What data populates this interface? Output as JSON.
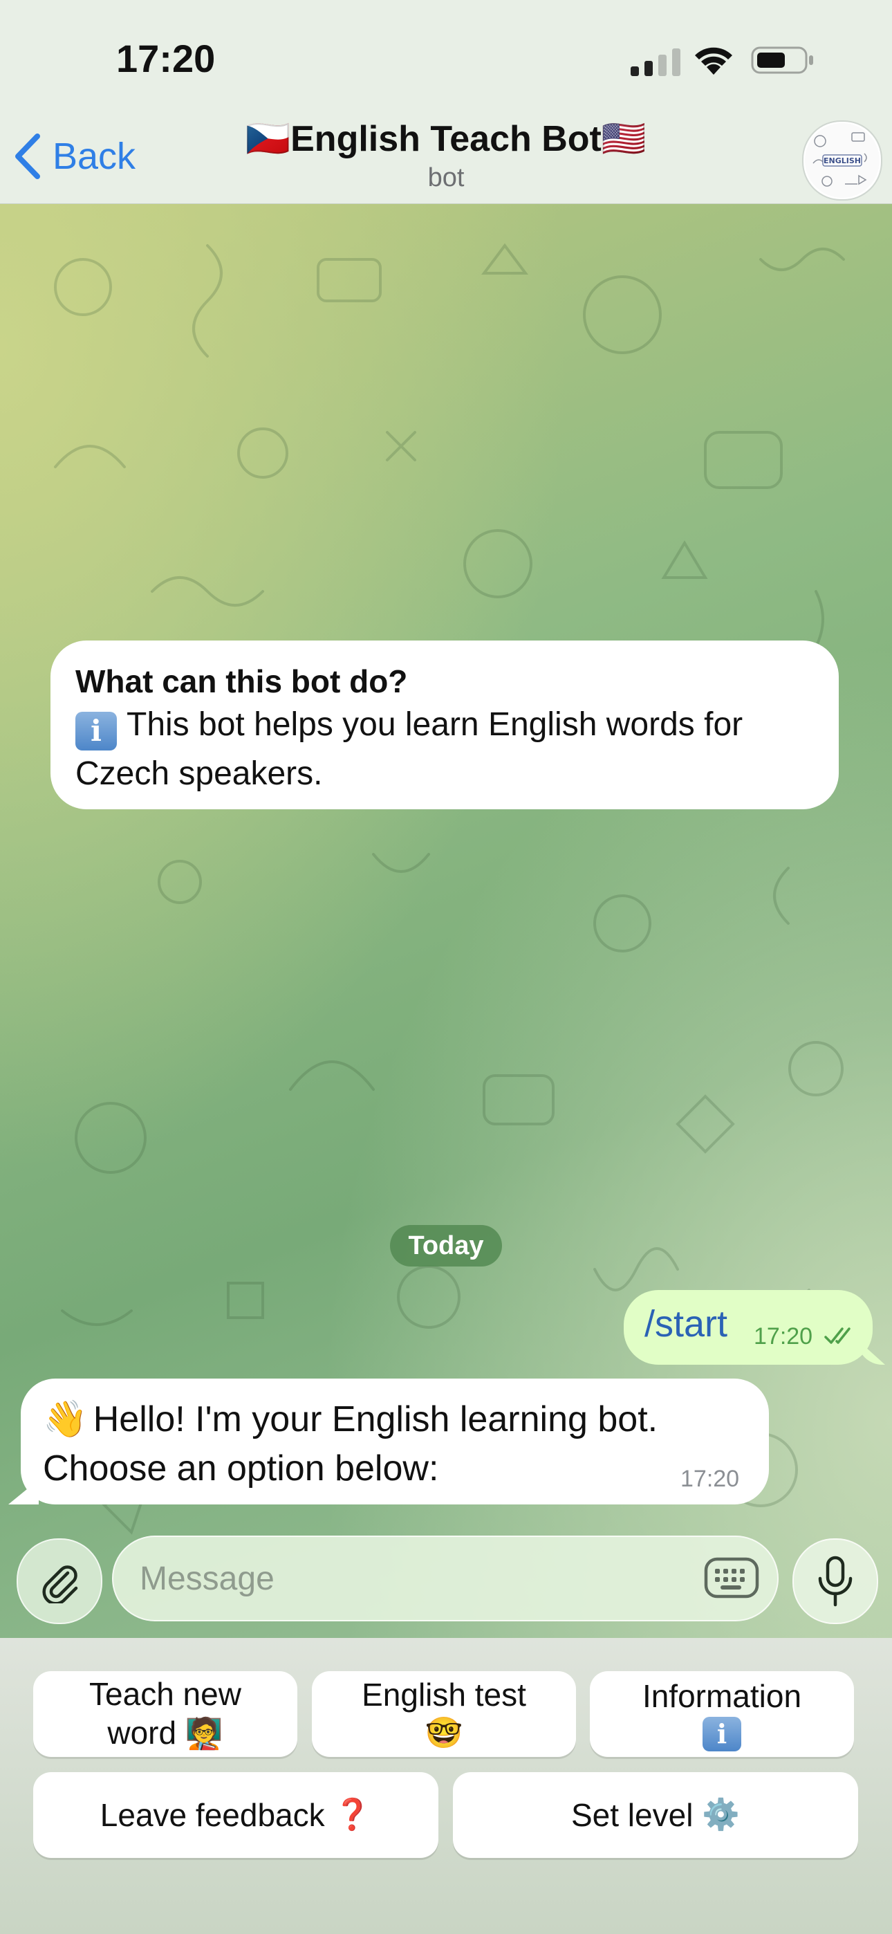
{
  "status_bar": {
    "time": "17:20"
  },
  "header": {
    "back_label": "Back",
    "title": "🇨🇿English Teach Bot🇺🇸",
    "subtitle": "bot",
    "avatar_text": "ENGLISH"
  },
  "info_card": {
    "title": "What can this bot do?",
    "info_glyph": "i",
    "description": "This bot helps you learn English words for Czech speakers."
  },
  "date_separator": "Today",
  "messages": [
    {
      "direction": "outgoing",
      "text": "/start",
      "time": "17:20",
      "status": "read"
    },
    {
      "direction": "incoming",
      "emoji": "👋",
      "line1": "Hello! I'm your English learning bot.",
      "line2": "Choose an option below:",
      "time": "17:20"
    }
  ],
  "composer": {
    "placeholder": "Message"
  },
  "reply_keyboard": {
    "row1": [
      {
        "line1": "Teach new",
        "line2": "word",
        "emoji": "🧑‍🏫"
      },
      {
        "line1": "English test",
        "emoji": "🤓"
      },
      {
        "line1": "Information",
        "emoji": "ℹ️"
      }
    ],
    "row2": [
      {
        "label": "Leave feedback",
        "emoji": "❓"
      },
      {
        "label": "Set level",
        "emoji": "⚙️"
      }
    ]
  },
  "colors": {
    "accent": "#2f7fe6",
    "outgoing_bubble": "#e1fec6",
    "incoming_bubble": "#ffffff",
    "read_check": "#4fa04a",
    "date_pill": "#538a52"
  }
}
